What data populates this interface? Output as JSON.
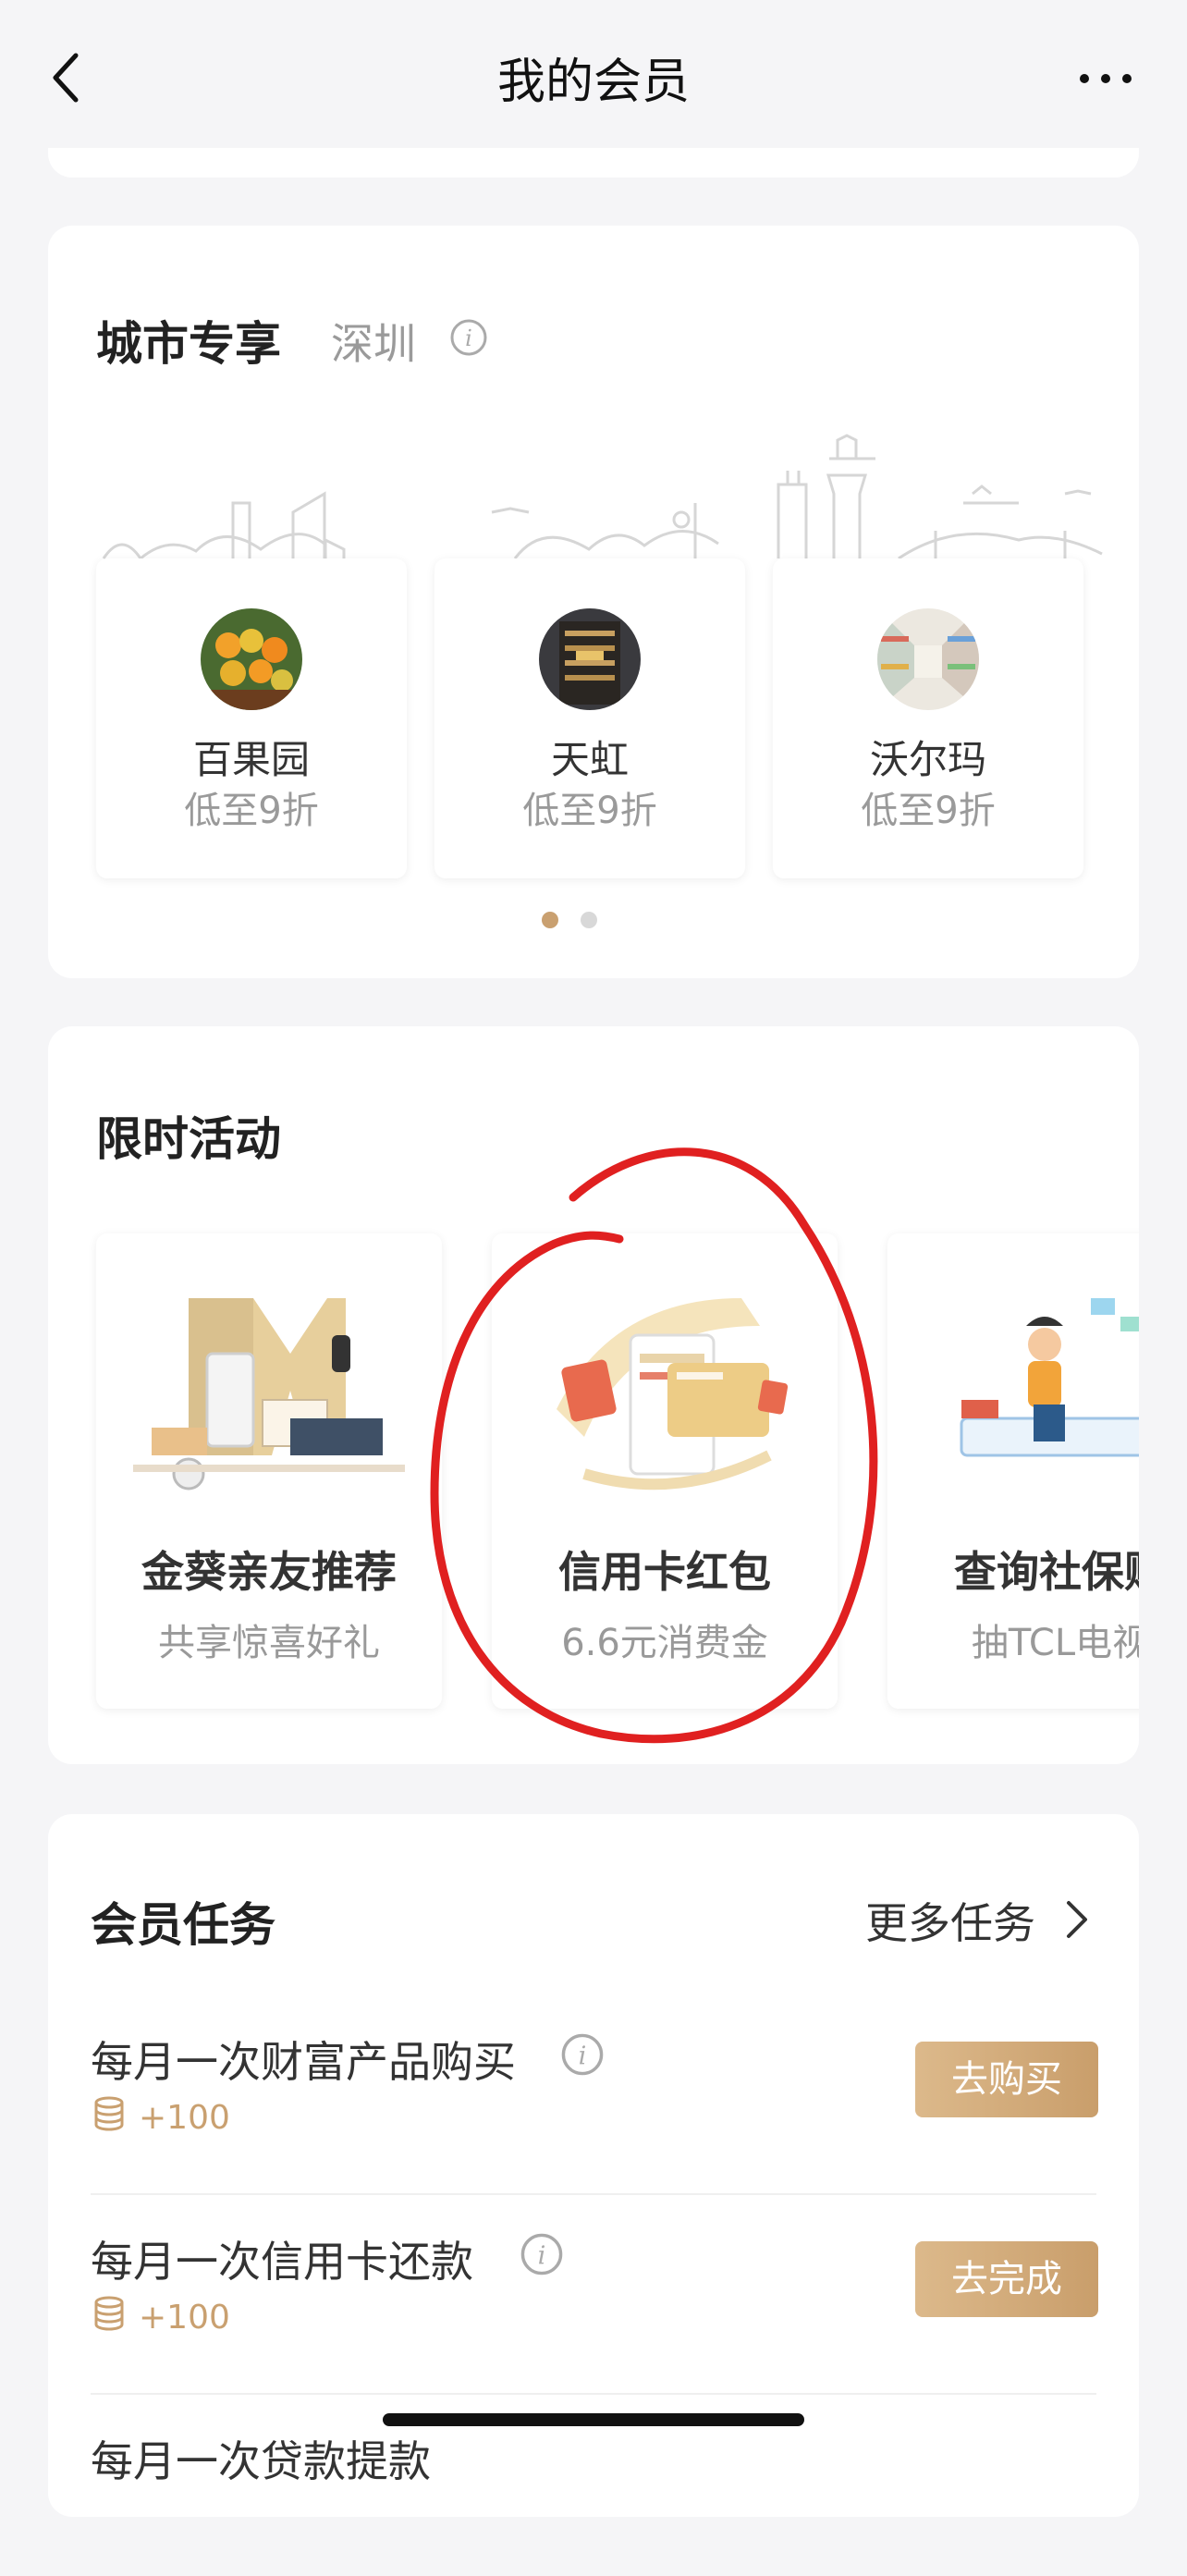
{
  "nav": {
    "title": "我的会员",
    "back_icon": "chevron-left-icon",
    "more_icon": "more-dots-icon"
  },
  "city": {
    "title": "城市专享",
    "city_name": "深圳",
    "info_icon": "info-icon",
    "stores": [
      {
        "name": "百果园",
        "discount": "低至9折"
      },
      {
        "name": "天虹",
        "discount": "低至9折"
      },
      {
        "name": "沃尔玛",
        "discount": "低至9折"
      }
    ],
    "page_dots": 2,
    "active_dot": 0
  },
  "activities": {
    "title": "限时活动",
    "items": [
      {
        "title": "金葵亲友推荐",
        "subtitle": "共享惊喜好礼"
      },
      {
        "title": "信用卡红包",
        "subtitle": "6.6元消费金"
      },
      {
        "title": "查询社保账",
        "subtitle": "抽TCL电视"
      }
    ]
  },
  "tasks": {
    "title": "会员任务",
    "more_label": "更多任务",
    "items": [
      {
        "name": "每月一次财富产品购买",
        "points": "+100",
        "button": "去购买"
      },
      {
        "name": "每月一次信用卡还款",
        "points": "+100",
        "button": "去完成"
      },
      {
        "name": "每月一次贷款提款",
        "points": "",
        "button": ""
      }
    ]
  },
  "colors": {
    "accent_gold": "#c9a070",
    "annotation_red": "#e02020"
  }
}
